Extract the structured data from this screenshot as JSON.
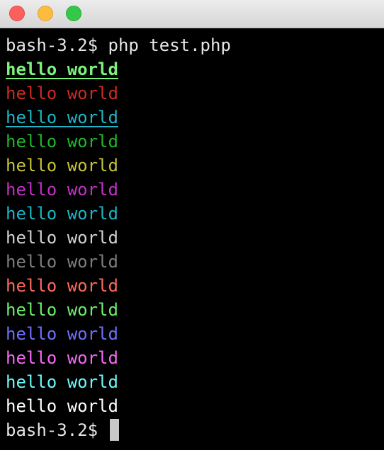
{
  "window": {
    "buttons": [
      "close",
      "minimize",
      "zoom"
    ]
  },
  "terminal": {
    "prompt": "bash-3.2$ ",
    "command": "php test.php",
    "output": [
      {
        "text": "hello world",
        "color": "#7cf27c",
        "bold": true,
        "underline": true
      },
      {
        "text": "hello world",
        "color": "#cc2b22",
        "bold": false,
        "underline": false
      },
      {
        "text": "hello world",
        "color": "#20b4c6",
        "bold": false,
        "underline": true
      },
      {
        "text": "hello world",
        "color": "#1fb82a",
        "bold": false,
        "underline": false
      },
      {
        "text": "hello world",
        "color": "#c6c23a",
        "bold": false,
        "underline": false
      },
      {
        "text": "hello world",
        "color": "#c331c6",
        "bold": false,
        "underline": false
      },
      {
        "text": "hello world",
        "color": "#1fb3c4",
        "bold": false,
        "underline": false
      },
      {
        "text": "hello world",
        "color": "#d2d2d2",
        "bold": false,
        "underline": false
      },
      {
        "text": "hello world",
        "color": "#7d7d7d",
        "bold": false,
        "underline": false
      },
      {
        "text": "hello world",
        "color": "#ff6a5c",
        "bold": false,
        "underline": false
      },
      {
        "text": "hello world",
        "color": "#6ef06a",
        "bold": false,
        "underline": false
      },
      {
        "text": "hello world",
        "color": "#6f6ffc",
        "bold": false,
        "underline": false
      },
      {
        "text": "hello world",
        "color": "#f56bf5",
        "bold": false,
        "underline": false
      },
      {
        "text": "hello world",
        "color": "#6ef8f8",
        "bold": false,
        "underline": false
      },
      {
        "text": "hello world",
        "color": "#ffffff",
        "bold": false,
        "underline": false
      }
    ],
    "final_prompt": "bash-3.2$ "
  }
}
